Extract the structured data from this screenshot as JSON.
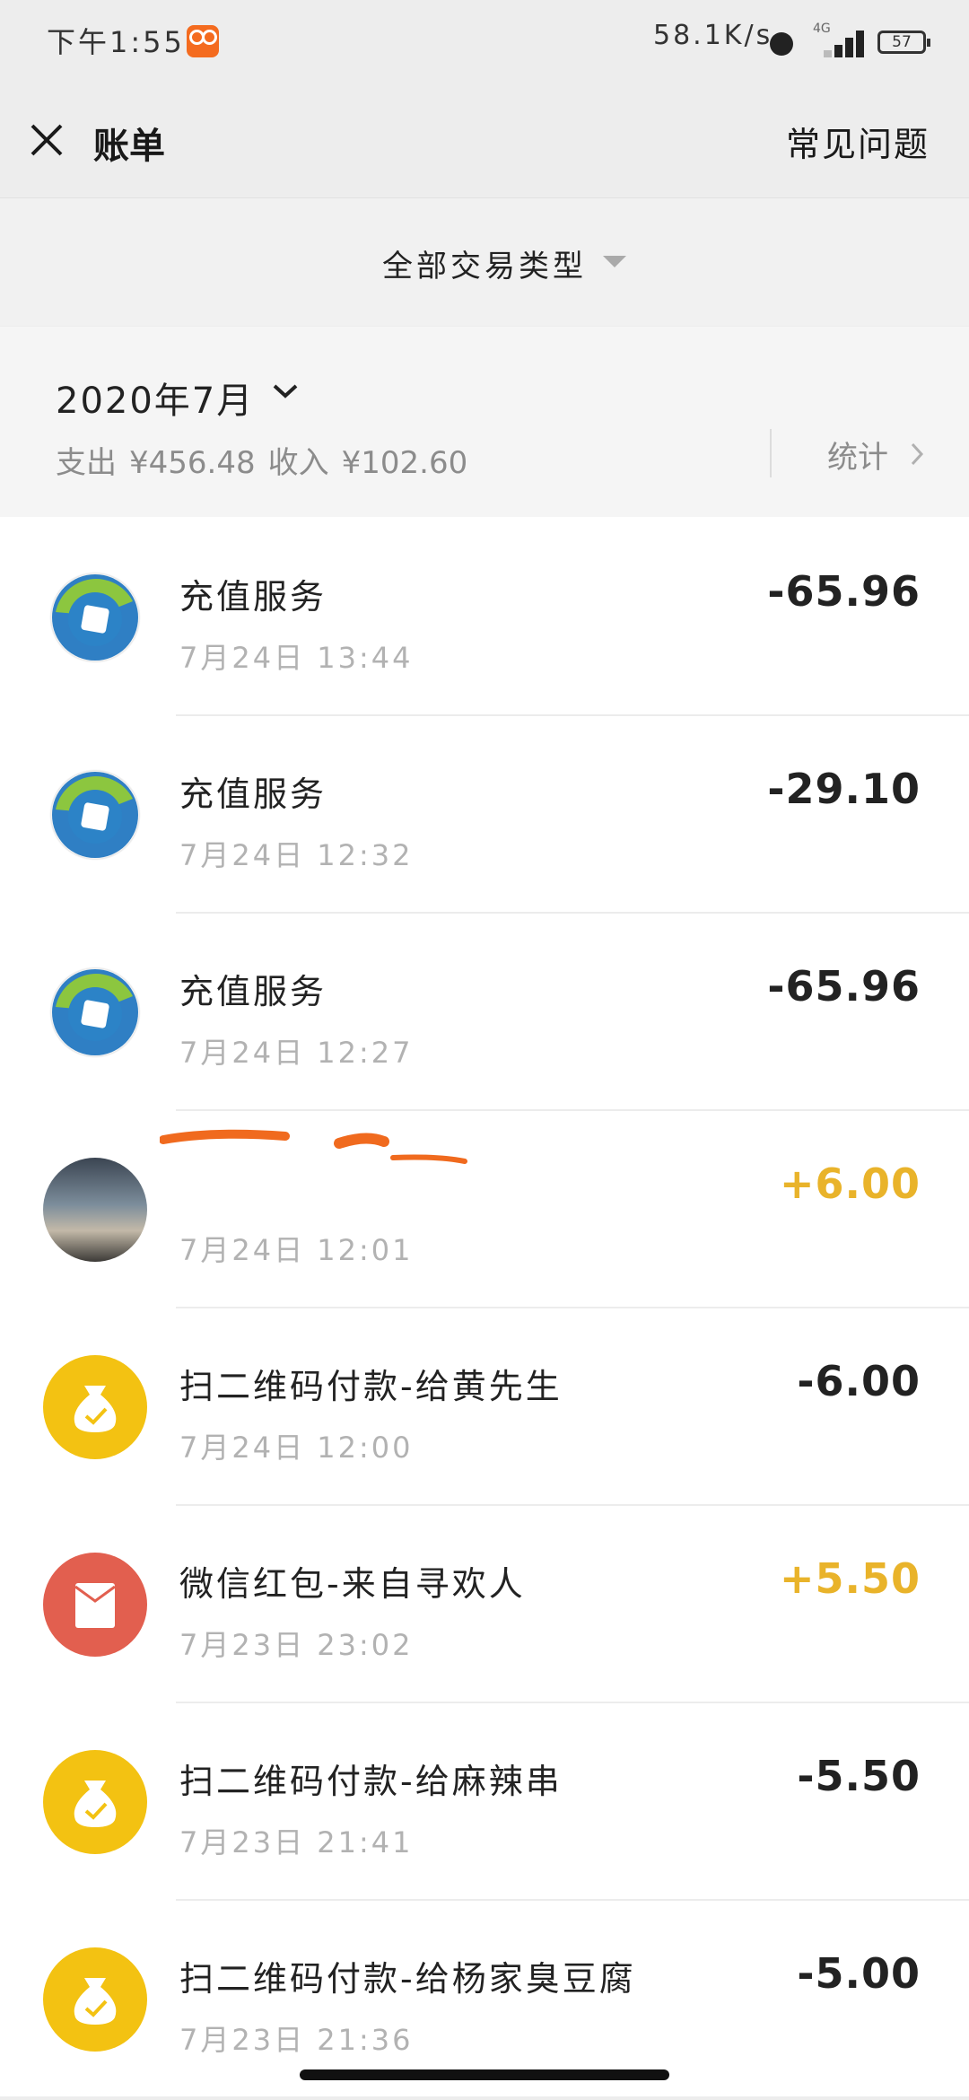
{
  "status_bar": {
    "time": "下午1:55",
    "net_speed": "58.1K/s",
    "network_type": "4G",
    "battery": "57"
  },
  "header": {
    "title": "账单",
    "faq_label": "常见问题"
  },
  "filter": {
    "label": "全部交易类型"
  },
  "summary": {
    "month": "2020年7月",
    "expense_label": "支出",
    "expense_value": "¥456.48",
    "income_label": "收入",
    "income_value": "¥102.60",
    "stats_label": "统计"
  },
  "transactions": [
    {
      "icon": "recharge-service-icon",
      "title": "充值服务",
      "time": "7月24日 13:44",
      "amount": "-65.96",
      "kind": "expense"
    },
    {
      "icon": "recharge-service-icon",
      "title": "充值服务",
      "time": "7月24日 12:32",
      "amount": "-29.10",
      "kind": "expense"
    },
    {
      "icon": "recharge-service-icon",
      "title": "充值服务",
      "time": "7月24日 12:27",
      "amount": "-65.96",
      "kind": "expense"
    },
    {
      "icon": "user-avatar-photo",
      "title": "",
      "time": "7月24日 12:01",
      "amount": "+6.00",
      "kind": "income"
    },
    {
      "icon": "money-bag-icon",
      "title": "扫二维码付款-给黄先生",
      "time": "7月24日 12:00",
      "amount": "-6.00",
      "kind": "expense"
    },
    {
      "icon": "red-packet-icon",
      "title": "微信红包-来自寻欢人",
      "time": "7月23日 23:02",
      "amount": "+5.50",
      "kind": "income"
    },
    {
      "icon": "money-bag-icon",
      "title": "扫二维码付款-给麻辣串",
      "time": "7月23日 21:41",
      "amount": "-5.50",
      "kind": "expense"
    },
    {
      "icon": "money-bag-icon",
      "title": "扫二维码付款-给杨家臭豆腐",
      "time": "7月23日 21:36",
      "amount": "-5.00",
      "kind": "expense"
    }
  ],
  "colors": {
    "income": "#e9b32a",
    "expense": "#222222",
    "page_bg": "#ededed"
  }
}
